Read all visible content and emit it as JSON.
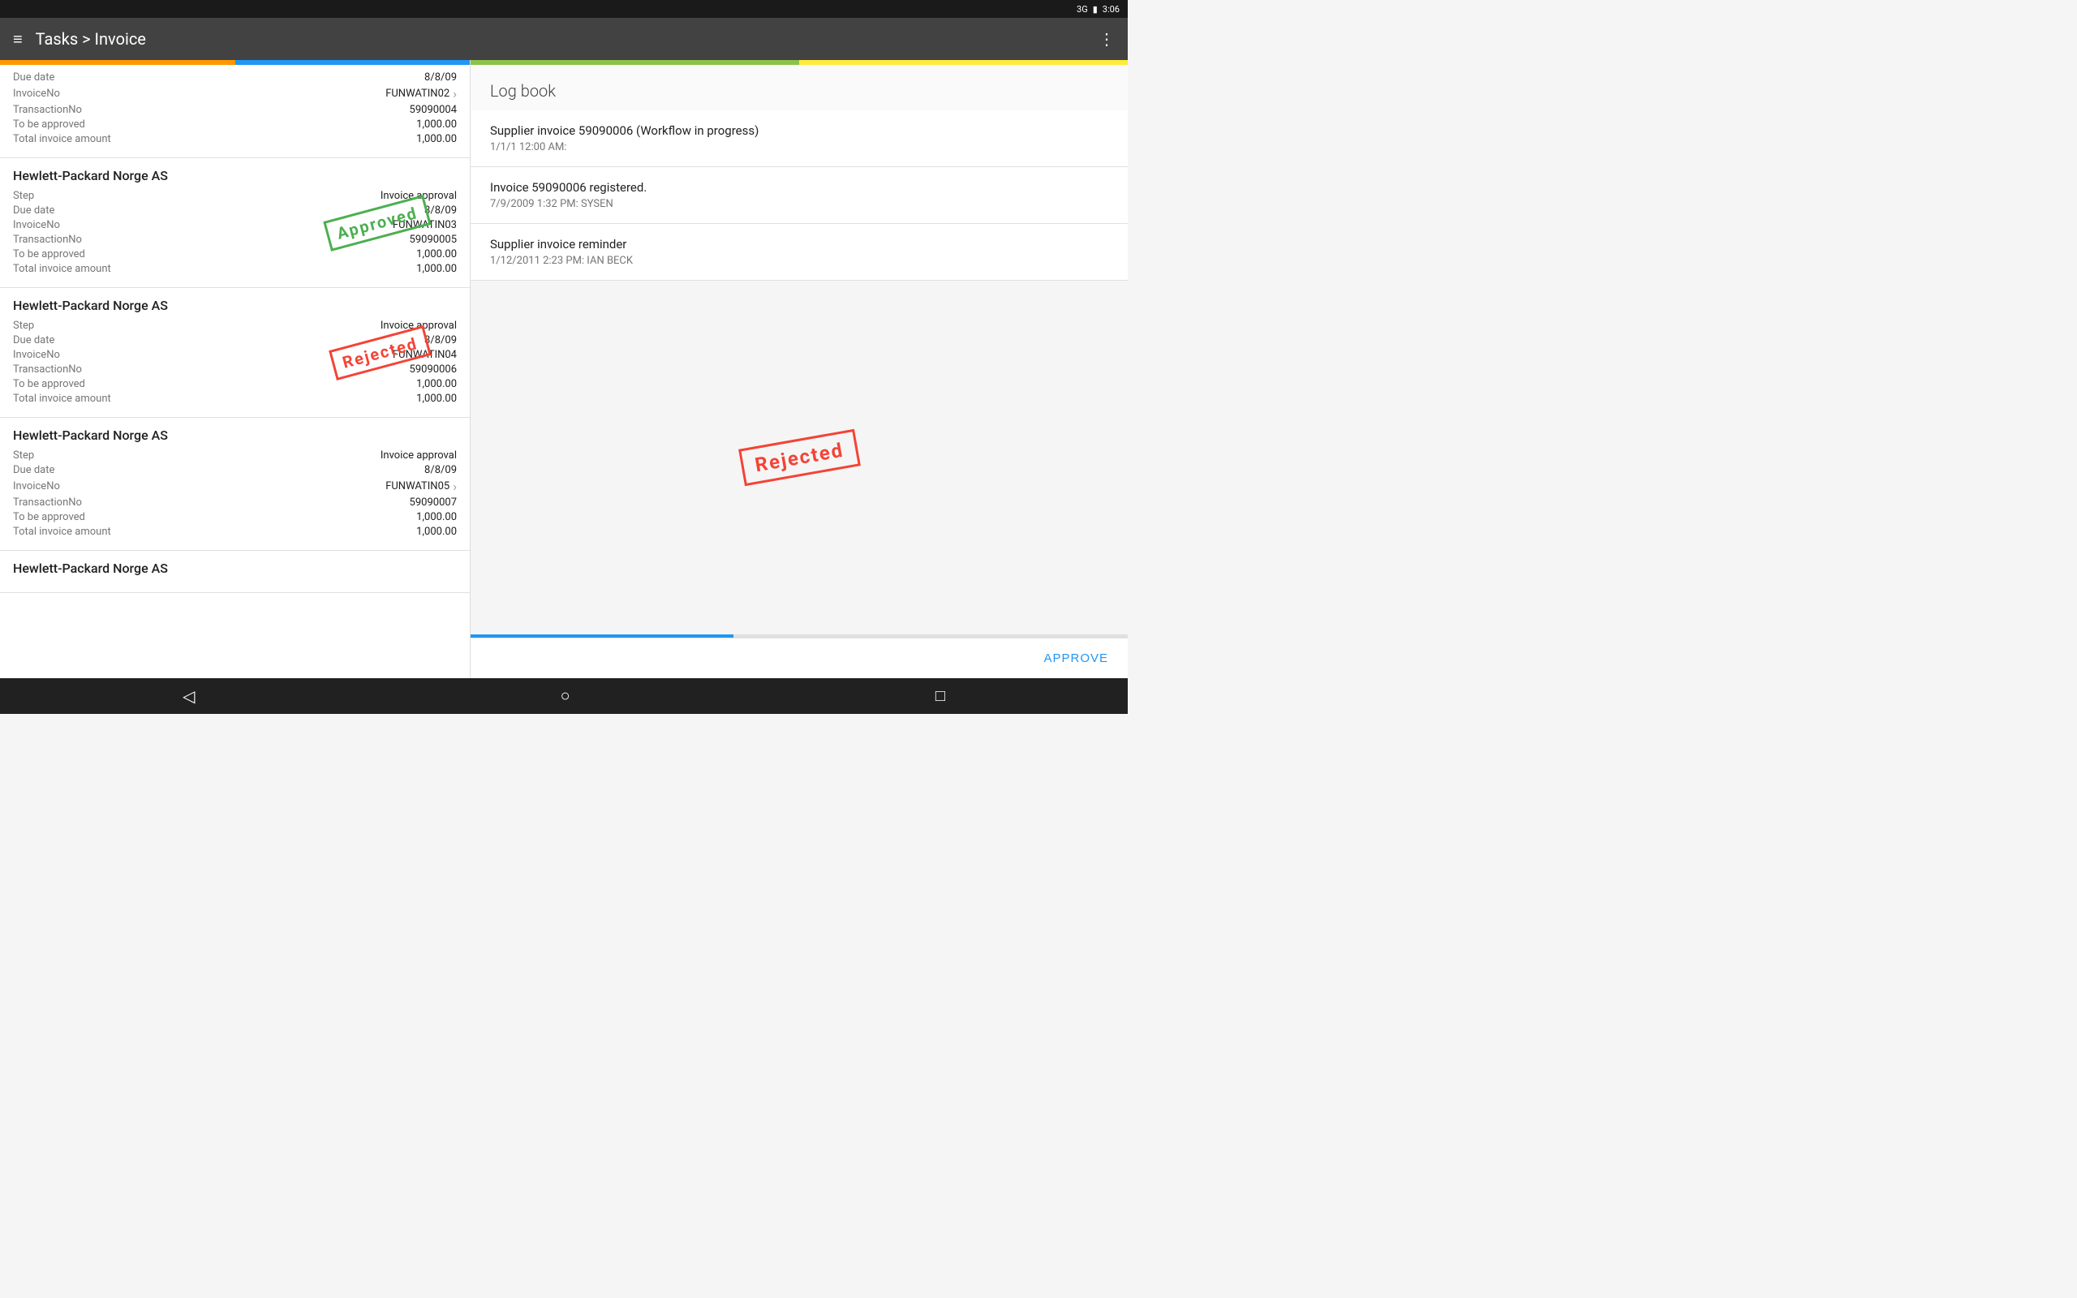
{
  "statusBar": {
    "signal": "3G",
    "battery": "🔋",
    "time": "3:06"
  },
  "appBar": {
    "title": "Tasks > Invoice",
    "menuIcon": "≡",
    "moreIcon": "⋮"
  },
  "leftPanel": {
    "partialItem": {
      "labels": [
        "Due date",
        "InvoiceNo",
        "TransactionNo",
        "To be approved",
        "Total invoice amount"
      ],
      "values": [
        "8/8/09",
        "FUNWATIN02",
        "59090004",
        "1,000.00",
        "1,000.00"
      ]
    },
    "items": [
      {
        "company": "Hewlett-Packard Norge AS",
        "step": "Invoice approval",
        "dueDate": "8/8/09",
        "invoiceNo": "FUNWATIN03",
        "transactionNo": "59090005",
        "toBeApproved": "1,000.00",
        "totalInvoiceAmount": "1,000.00",
        "stamp": "Approved",
        "stampType": "approved"
      },
      {
        "company": "Hewlett-Packard Norge AS",
        "step": "Invoice approval",
        "dueDate": "8/8/09",
        "invoiceNo": "FUNWATIN04",
        "transactionNo": "59090006",
        "toBeApproved": "1,000.00",
        "totalInvoiceAmount": "1,000.00",
        "stamp": "Rejected",
        "stampType": "rejected"
      },
      {
        "company": "Hewlett-Packard Norge AS",
        "step": "Invoice approval",
        "dueDate": "8/8/09",
        "invoiceNo": "FUNWATIN05",
        "transactionNo": "59090007",
        "toBeApproved": "1,000.00",
        "totalInvoiceAmount": "1,000.00",
        "stamp": null,
        "stampType": null,
        "hasChevron": true
      },
      {
        "company": "Hewlett-Packard Norge AS",
        "step": null,
        "partial": true
      }
    ]
  },
  "rightPanel": {
    "logbookTitle": "Log book",
    "entries": [
      {
        "title": "Supplier invoice 59090006 (Workflow in progress)",
        "meta": "1/1/1 12:00 AM:"
      },
      {
        "title": "Invoice 59090006 registered.",
        "meta": "7/9/2009 1:32 PM: SYSEN"
      },
      {
        "title": "Supplier invoice reminder",
        "meta": "1/12/2011 2:23 PM: IAN BECK"
      }
    ],
    "rejectedStamp": "Rejected",
    "approveButton": "APPROVE"
  },
  "fields": {
    "step": "Step",
    "dueDate": "Due date",
    "invoiceNo": "InvoiceNo",
    "transactionNo": "TransactionNo",
    "toBeApproved": "To be approved",
    "totalInvoiceAmount": "Total invoice amount"
  },
  "bottomNav": {
    "back": "◁",
    "home": "○",
    "square": "□"
  }
}
